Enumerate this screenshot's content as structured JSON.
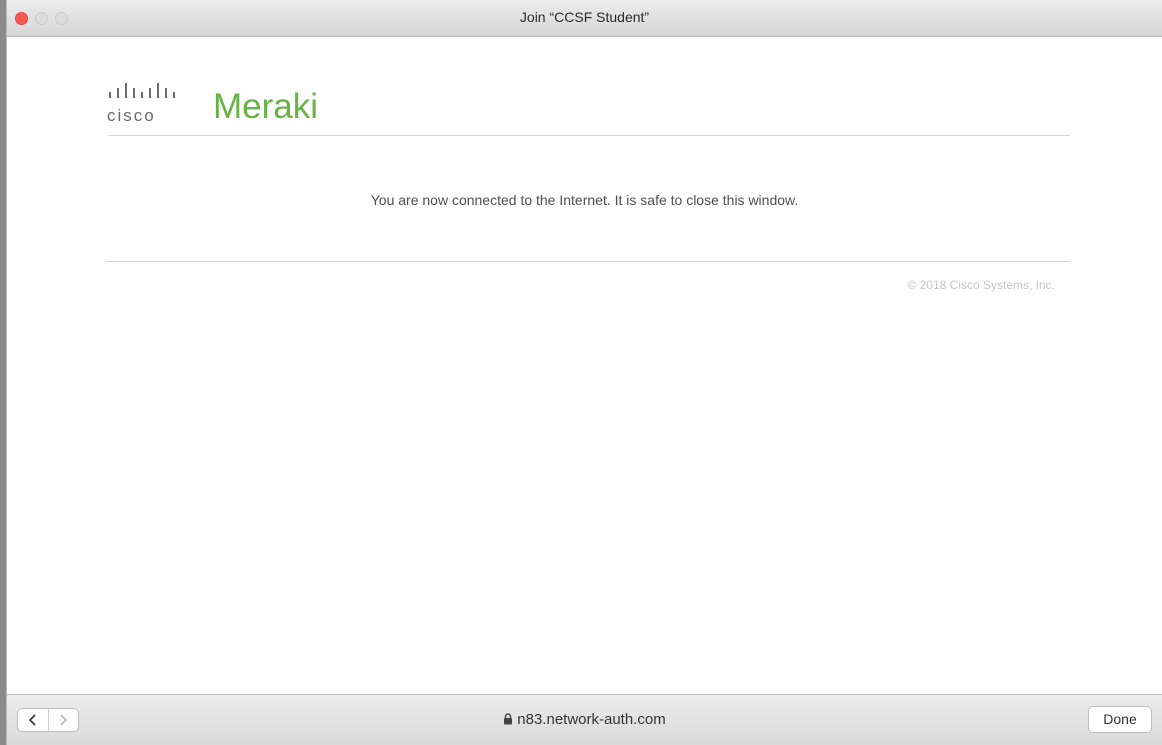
{
  "window": {
    "title": "Join “CCSF Student”"
  },
  "logo": {
    "cisco_text": "cisco",
    "meraki_text": "Meraki",
    "meraki_color": "#67b346"
  },
  "main": {
    "message": "You are now connected to the Internet. It is safe to close this window.",
    "copyright": "© 2018 Cisco Systems, Inc."
  },
  "toolbar": {
    "back_icon": "chevron-left-icon",
    "forward_icon": "chevron-right-icon",
    "url": "n83.network-auth.com",
    "secure_icon": "lock-icon",
    "done_label": "Done"
  }
}
